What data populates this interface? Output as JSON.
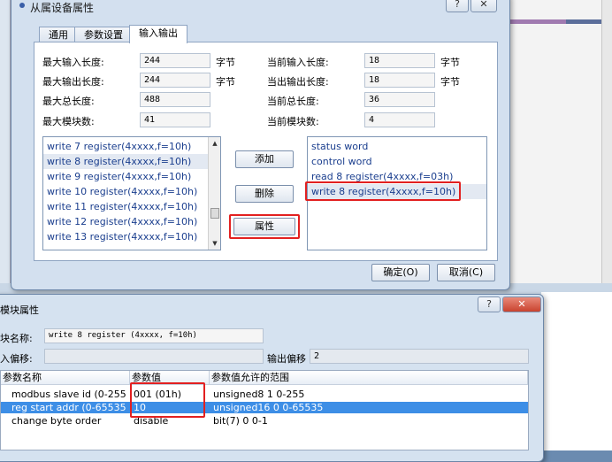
{
  "dialog1": {
    "title": "从属设备属性",
    "tabs": [
      "通用",
      "参数设置",
      "输入输出"
    ],
    "fields": {
      "max_input_len_label": "最大输入长度:",
      "max_input_len": "244",
      "max_input_unit": "字节",
      "cur_input_len_label": "当前输入长度:",
      "cur_input_len": "18",
      "cur_input_unit": "字节",
      "max_output_len_label": "最大输出长度:",
      "max_output_len": "244",
      "max_output_unit": "字节",
      "cur_output_len_label": "当出输出长度:",
      "cur_output_len": "18",
      "cur_output_unit": "字节",
      "max_total_len_label": "最大总长度:",
      "max_total_len": "488",
      "cur_total_len_label": "当前总长度:",
      "cur_total_len": "36",
      "max_modules_label": "最大模块数:",
      "max_modules": "41",
      "cur_modules_label": "当前模块数:",
      "cur_modules": "4"
    },
    "available_modules": [
      "write 7 register(4xxxx,f=10h)",
      "write 8 register(4xxxx,f=10h)",
      "write 9 register(4xxxx,f=10h)",
      "write 10 register(4xxxx,f=10h)",
      "write 11 register(4xxxx,f=10h)",
      "write 12 register(4xxxx,f=10h)",
      "write 13 register(4xxxx,f=10h)"
    ],
    "configured_modules": [
      "status word",
      "control word",
      "read 8 register(4xxxx,f=03h)",
      "write 8 register(4xxxx,f=10h)"
    ],
    "buttons": {
      "add": "添加",
      "delete": "删除",
      "properties": "属性",
      "ok": "确定(O)",
      "cancel": "取消(C)"
    },
    "caption": {
      "help": "?",
      "close": "✕"
    }
  },
  "dialog2": {
    "title": "模块属性",
    "module_name_label": "块名称:",
    "module_name": "write 8 register (4xxxx, f=10h)",
    "input_offset_label": "入偏移:",
    "input_offset": "",
    "output_offset_label": "输出偏移",
    "output_offset": "2",
    "columns": [
      "参数名称",
      "参数值",
      "参数值允许的范围"
    ],
    "rows": [
      {
        "name": "modbus slave id (0-255",
        "value": "001 (01h)",
        "range": "unsigned8 1 0-255"
      },
      {
        "name": "reg start addr (0-65535",
        "value": "10",
        "range": "unsigned16 0 0-65535"
      },
      {
        "name": "change byte order",
        "value": "disable",
        "range": "bit(7) 0 0-1"
      }
    ],
    "caption": {
      "help": "?",
      "close": "✕"
    }
  }
}
